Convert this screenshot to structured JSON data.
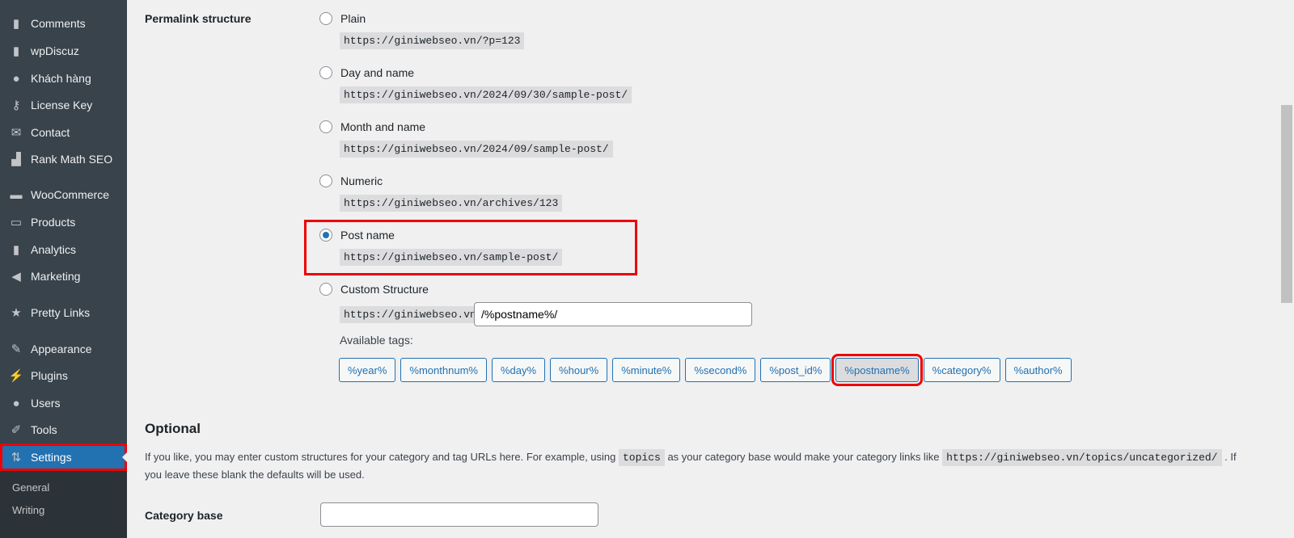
{
  "sidebar": {
    "items": [
      {
        "label": "Comments",
        "icon": "comment-icon"
      },
      {
        "label": "wpDiscuz",
        "icon": "comment-icon"
      },
      {
        "label": "Khách hàng",
        "icon": "user-icon"
      },
      {
        "label": "License Key",
        "icon": "key-icon"
      },
      {
        "label": "Contact",
        "icon": "mail-icon"
      },
      {
        "label": "Rank Math SEO",
        "icon": "rank-math-icon"
      },
      {
        "label": "WooCommerce",
        "icon": "woo-icon"
      },
      {
        "label": "Products",
        "icon": "archive-icon"
      },
      {
        "label": "Analytics",
        "icon": "bar-chart-icon"
      },
      {
        "label": "Marketing",
        "icon": "megaphone-icon"
      },
      {
        "label": "Pretty Links",
        "icon": "star-icon"
      },
      {
        "label": "Appearance",
        "icon": "brush-icon"
      },
      {
        "label": "Plugins",
        "icon": "plug-icon"
      },
      {
        "label": "Users",
        "icon": "user-icon"
      },
      {
        "label": "Tools",
        "icon": "wrench-icon"
      },
      {
        "label": "Settings",
        "icon": "settings-icon",
        "active": true
      }
    ],
    "submenu": [
      "General",
      "Writing"
    ]
  },
  "permalink": {
    "label": "Permalink structure",
    "options": [
      {
        "label": "Plain",
        "url": "https://giniwebseo.vn/?p=123"
      },
      {
        "label": "Day and name",
        "url": "https://giniwebseo.vn/2024/09/30/sample-post/"
      },
      {
        "label": "Month and name",
        "url": "https://giniwebseo.vn/2024/09/sample-post/"
      },
      {
        "label": "Numeric",
        "url": "https://giniwebseo.vn/archives/123"
      },
      {
        "label": "Post name",
        "url": "https://giniwebseo.vn/sample-post/",
        "selected": true
      },
      {
        "label": "Custom Structure",
        "url": "https://giniwebseo.vn"
      }
    ],
    "custom_value": "/%postname%/",
    "available_tags_label": "Available tags:",
    "tags": [
      "%year%",
      "%monthnum%",
      "%day%",
      "%hour%",
      "%minute%",
      "%second%",
      "%post_id%",
      "%postname%",
      "%category%",
      "%author%"
    ],
    "selected_tag": "%postname%"
  },
  "optional": {
    "title": "Optional",
    "text1": "If you like, you may enter custom structures for your category and tag URLs here. For example, using",
    "code1": "topics",
    "text2": "as your category base would make your category links like",
    "code2": "https://giniwebseo.vn/topics/uncategorized/",
    "text3": ". If you leave these blank the defaults will be used.",
    "category_base_label": "Category base",
    "category_base_value": ""
  },
  "colors": {
    "accent": "#2271b1",
    "highlight": "#ee0000",
    "sidebar": "#38434b"
  }
}
